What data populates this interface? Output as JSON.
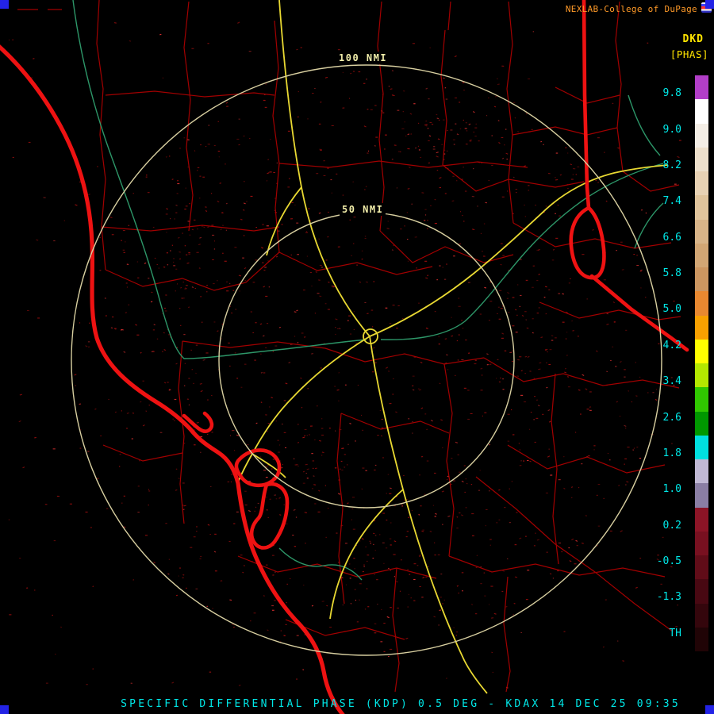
{
  "brand": {
    "text": "NEXLAB-College of DuPage"
  },
  "scale": {
    "product_code": "DKD",
    "units_label": "[PHAS]",
    "tick_labels": [
      "9.8",
      "9.0",
      "8.2",
      "7.4",
      "6.6",
      "5.8",
      "5.0",
      "4.2",
      "3.4",
      "2.6",
      "1.8",
      "1.0",
      "0.2",
      "-0.5",
      "-1.3",
      "TH"
    ],
    "bar_colors": [
      "#b23ec8",
      "#ffffff",
      "#f4eee6",
      "#eee0cc",
      "#e8d2b4",
      "#e0c49c",
      "#d8b488",
      "#d2a674",
      "#cc9660",
      "#e88830",
      "#f8a000",
      "#ffff00",
      "#b4e800",
      "#30c800",
      "#009800",
      "#00e0e0",
      "#c0b8d4",
      "#8a7ea4",
      "#8c1426",
      "#781020",
      "#600c18",
      "#480812",
      "#34060c",
      "#200406"
    ]
  },
  "map": {
    "radar_site": "KDAX",
    "range_rings": {
      "outer_label": "100 NMI",
      "inner_label": "50 NMI"
    }
  },
  "footer": {
    "caption": "SPECIFIC DIFFERENTIAL PHASE (KDP) 0.5 DEG - KDAX 14 DEC 25 09:35"
  },
  "colors": {
    "bg": "#000000",
    "county": "#b40000",
    "stateborder": "#ee1212",
    "highway": "#e8d832",
    "river": "#2f9e6e",
    "ring": "#d8cfa0",
    "ringlabel": "#f2eeaa",
    "cyan": "#00e8e8",
    "yellow": "#ffe400",
    "brand": "#ff9a28",
    "corner": "#2323e6",
    "speckle": "#9c0e0e",
    "speckle2": "#e03030"
  }
}
